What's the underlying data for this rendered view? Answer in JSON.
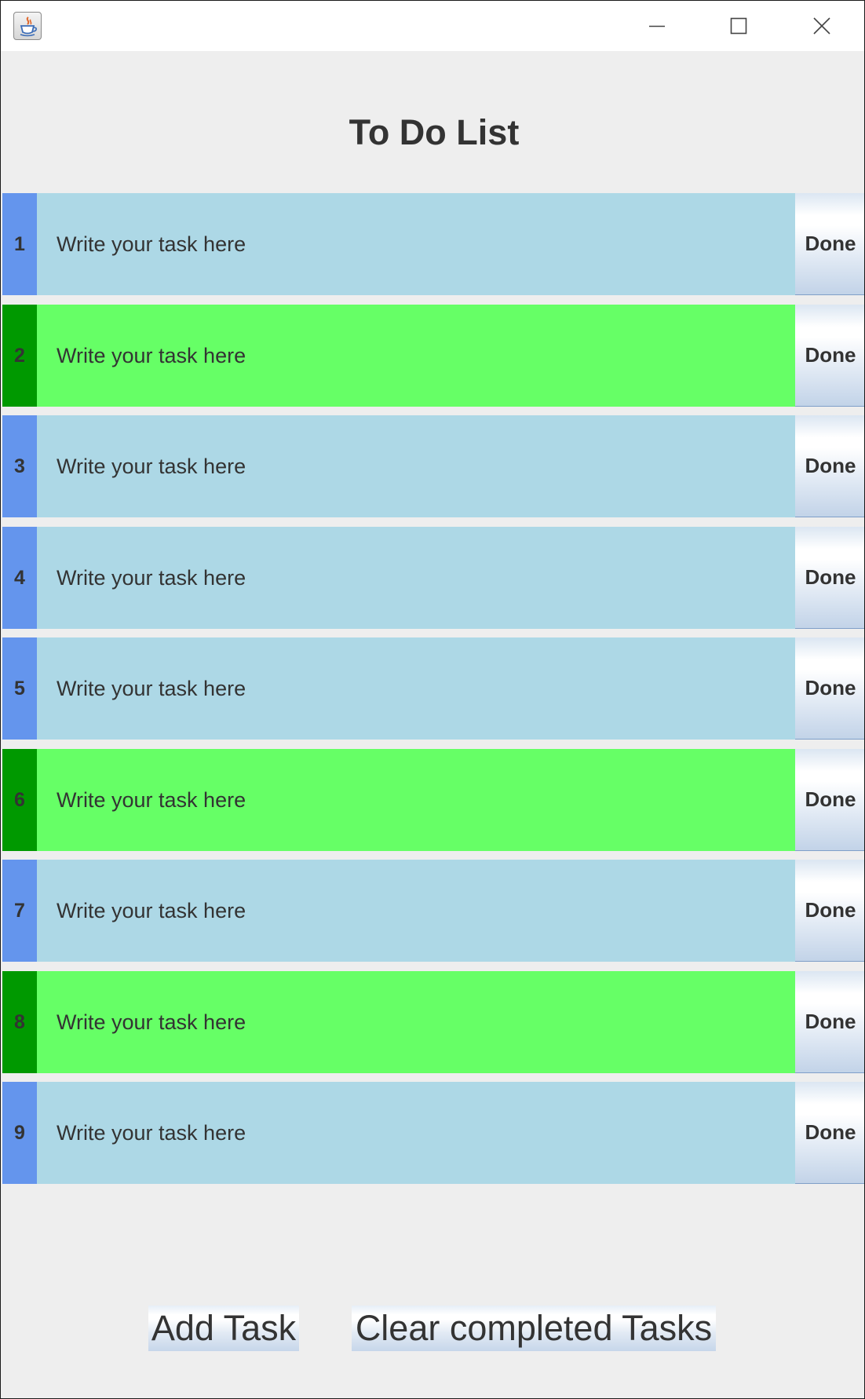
{
  "window": {
    "controls": [
      "minimize",
      "maximize",
      "close"
    ]
  },
  "app": {
    "title": "To Do List"
  },
  "tasks": [
    {
      "number": "1",
      "text": "Write your task here",
      "done_label": "Done",
      "completed": false
    },
    {
      "number": "2",
      "text": "Write your task here",
      "done_label": "Done",
      "completed": true
    },
    {
      "number": "3",
      "text": "Write your task here",
      "done_label": "Done",
      "completed": false
    },
    {
      "number": "4",
      "text": "Write your task here",
      "done_label": "Done",
      "completed": false
    },
    {
      "number": "5",
      "text": "Write your task here",
      "done_label": "Done",
      "completed": false
    },
    {
      "number": "6",
      "text": "Write your task here",
      "done_label": "Done",
      "completed": true
    },
    {
      "number": "7",
      "text": "Write your task here",
      "done_label": "Done",
      "completed": false
    },
    {
      "number": "8",
      "text": "Write your task here",
      "done_label": "Done",
      "completed": true
    },
    {
      "number": "9",
      "text": "Write your task here",
      "done_label": "Done",
      "completed": false
    }
  ],
  "footer": {
    "add_label": "Add Task",
    "clear_label": "Clear completed Tasks"
  },
  "colors": {
    "pending_number_bg": "#6495ed",
    "pending_text_bg": "#add8e6",
    "completed_number_bg": "#009900",
    "completed_text_bg": "#66ff66",
    "window_bg": "#eeeeee",
    "text": "#333333"
  },
  "icons": {
    "app": "java-coffee-cup-icon",
    "minimize": "minimize-icon",
    "maximize": "maximize-icon",
    "close": "close-icon"
  }
}
